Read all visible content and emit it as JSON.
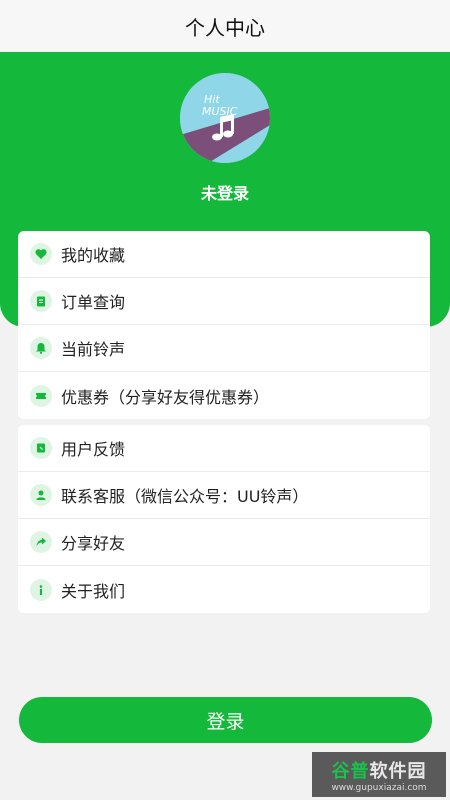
{
  "header": {
    "title": "个人中心"
  },
  "profile": {
    "status": "未登录",
    "avatar_text": [
      "Hit",
      "MUSIC"
    ]
  },
  "menu_group_1": [
    {
      "label": "我的收藏",
      "icon": "heart-icon"
    },
    {
      "label": "订单查询",
      "icon": "clipboard-icon"
    },
    {
      "label": "当前铃声",
      "icon": "bell-icon"
    },
    {
      "label": "优惠券（分享好友得优惠券）",
      "icon": "ticket-icon"
    }
  ],
  "menu_group_2": [
    {
      "label": "用户反馈",
      "icon": "feedback-icon"
    },
    {
      "label": "联系客服（微信公众号：UU铃声）",
      "icon": "customer-service-icon"
    },
    {
      "label": "分享好友",
      "icon": "share-icon"
    },
    {
      "label": "关于我们",
      "icon": "info-icon"
    }
  ],
  "login_button": {
    "label": "登录"
  },
  "watermark": {
    "brand_part1": "谷普",
    "brand_part2": "软件园",
    "url": "www.gupuxiazai.com"
  },
  "colors": {
    "accent": "#14b83b",
    "icon_bg": "#dff5e4",
    "background": "#f2f2f2"
  }
}
